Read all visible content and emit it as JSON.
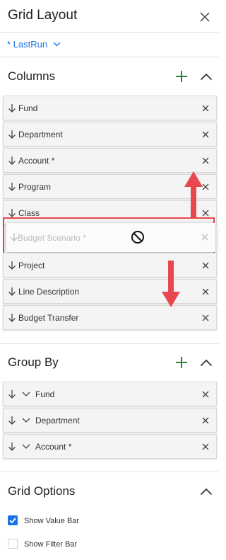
{
  "panel": {
    "title": "Grid Layout"
  },
  "view": {
    "selected": "* LastRun"
  },
  "columns": {
    "title": "Columns",
    "items": [
      {
        "label": "Fund"
      },
      {
        "label": "Department"
      },
      {
        "label": "Account *"
      },
      {
        "label": "Program"
      },
      {
        "label": "Class"
      },
      {
        "label": "Project"
      },
      {
        "label": "Line Description"
      },
      {
        "label": "Budget Transfer"
      }
    ],
    "dragging": {
      "label": "Budget Scenario *"
    }
  },
  "group_by": {
    "title": "Group By",
    "items": [
      {
        "label": "Fund"
      },
      {
        "label": "Department"
      },
      {
        "label": "Account *"
      }
    ]
  },
  "grid_options": {
    "title": "Grid Options",
    "options": [
      {
        "label": "Show Value Bar",
        "checked": true
      },
      {
        "label": "Show Filter Bar",
        "checked": false
      }
    ]
  },
  "colors": {
    "accent_blue": "#1a73e8",
    "add_green": "#2e7d32",
    "annotation_red": "#e8474f"
  }
}
